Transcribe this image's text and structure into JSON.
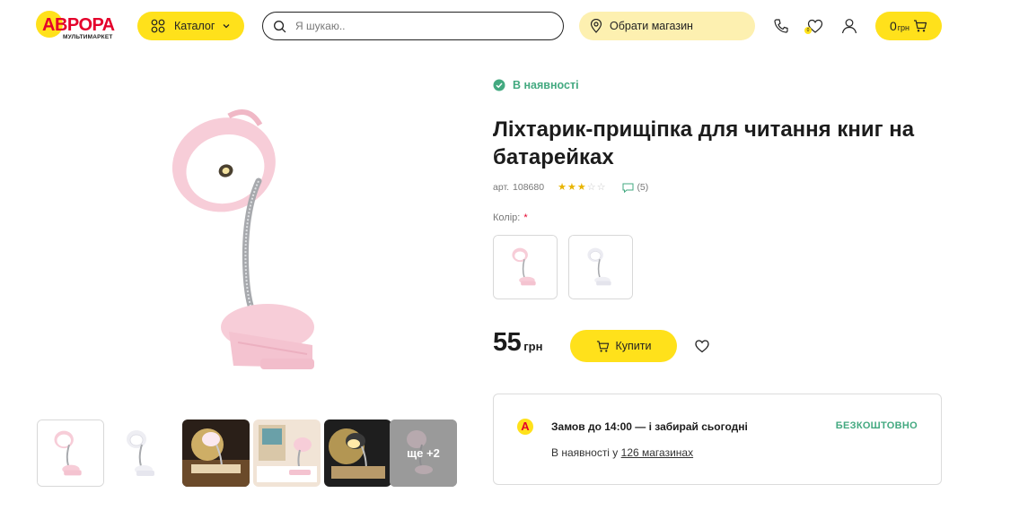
{
  "header": {
    "logo_text": "АВРОРА",
    "logo_subtext": "МУЛЬТИМАРКЕТ",
    "catalog_label": "Каталог",
    "search_placeholder": "Я шукаю..",
    "store_label": "Обрати магазин",
    "favorites_count": "0",
    "cart_amount": "0",
    "cart_currency": "грн"
  },
  "product": {
    "stock_status": "В наявності",
    "title": "Ліхтарик-прищіпка для читання книг на батарейках",
    "article_label": "арт.",
    "article_number": "108680",
    "rating": 3,
    "rating_max": 5,
    "reviews_count": "(5)",
    "color_label": "Колір:",
    "color_required_mark": "*",
    "color_options": [
      "рожевий",
      "білий"
    ],
    "price": "55",
    "currency": "грн",
    "buy_label": "Купити"
  },
  "gallery": {
    "more_label": "ще +2",
    "thumbnail_count": 6
  },
  "delivery": {
    "badge": "А",
    "headline": "Замов до 14:00 — і забирай сьогодні",
    "price_label": "БЕЗКОШТОВНО",
    "availability_prefix": "В наявності у",
    "availability_link": "126 магазинах"
  },
  "colors": {
    "brand_yellow": "#ffe11b",
    "brand_red": "#e4002b",
    "stock_green": "#43a980",
    "store_bg": "#fdf0b0",
    "lamp_pink": "#f7cdd8"
  },
  "icons": {
    "catalog": "grid-icon",
    "search": "search-icon",
    "store": "location-pin-icon",
    "phone": "phone-icon",
    "favorites": "heart-icon",
    "account": "user-icon",
    "cart": "cart-icon",
    "stock": "check-circle-icon",
    "comments": "comment-icon"
  }
}
